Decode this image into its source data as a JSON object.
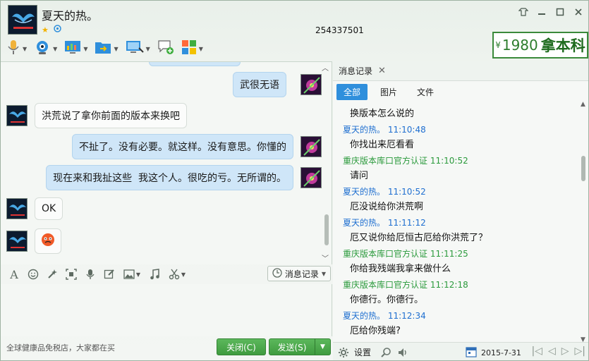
{
  "window": {
    "title": "夏天的热。",
    "qq_id": "254337501",
    "ad_text": "1980",
    "ad_text_bold": "拿本科",
    "ad_prefix": "¥"
  },
  "toolbar": {
    "items": [
      {
        "name": "voice-call",
        "icon": "microphone-icon"
      },
      {
        "name": "video-call",
        "icon": "webcam-icon"
      },
      {
        "name": "remote-assist",
        "icon": "chart-screen-icon"
      },
      {
        "name": "send-file",
        "icon": "folder-arrow-icon"
      },
      {
        "name": "share-screen",
        "icon": "monitor-icon"
      },
      {
        "name": "create-discussion",
        "icon": "chat-add-icon"
      },
      {
        "name": "apps",
        "icon": "app-grid-icon"
      }
    ]
  },
  "chat": {
    "messages": [
      {
        "side": "me",
        "text": "武很无语"
      },
      {
        "side": "other",
        "text": "洪荒说了拿你前面的版本来换吧"
      },
      {
        "side": "me",
        "text": "不扯了。没有必要。就这样。没有意思。你懂的"
      },
      {
        "side": "me",
        "text": "现在来和我扯这些  我这个人。很吃的亏。无所谓的。"
      },
      {
        "side": "other",
        "text": "OK"
      },
      {
        "side": "other",
        "text": "😡"
      }
    ]
  },
  "input_toolbar": {
    "history_label": "消息记录"
  },
  "footer": {
    "ad": "全球健康品免税店，大家都在买",
    "close_label": "关闭(C)",
    "send_label": "发送(S)"
  },
  "history": {
    "header": "消息记录",
    "tabs": [
      "全部",
      "图片",
      "文件"
    ],
    "active_tab": "全部",
    "entries": [
      {
        "kind": "msg",
        "text": "换版本怎么说的"
      },
      {
        "kind": "meta",
        "who": "夏天的热。",
        "time": "11:10:48",
        "color": "blue"
      },
      {
        "kind": "msg",
        "text": "你找出来厄看看"
      },
      {
        "kind": "meta",
        "who": "重庆版本库口官方认证",
        "time": "11:10:52",
        "color": "green"
      },
      {
        "kind": "msg",
        "text": "请问"
      },
      {
        "kind": "meta",
        "who": "夏天的热。",
        "time": "11:10:52",
        "color": "blue"
      },
      {
        "kind": "msg",
        "text": "厄没说给你洪荒啊"
      },
      {
        "kind": "meta",
        "who": "夏天的热。",
        "time": "11:11:12",
        "color": "blue"
      },
      {
        "kind": "msg",
        "text": "厄又说你给厄恒古厄给你洪荒了？"
      },
      {
        "kind": "meta",
        "who": "重庆版本库口官方认证",
        "time": "11:11:25",
        "color": "green"
      },
      {
        "kind": "msg",
        "text": "你给我残端我拿来做什么"
      },
      {
        "kind": "meta",
        "who": "重庆版本库口官方认证",
        "time": "11:12:18",
        "color": "green"
      },
      {
        "kind": "msg",
        "text": "你德行。你德行。"
      },
      {
        "kind": "meta",
        "who": "夏天的热。",
        "time": "11:12:34",
        "color": "blue"
      },
      {
        "kind": "msg",
        "text": "厄给你残端?"
      }
    ],
    "settings_label": "设置",
    "date": "2015-7-31"
  }
}
